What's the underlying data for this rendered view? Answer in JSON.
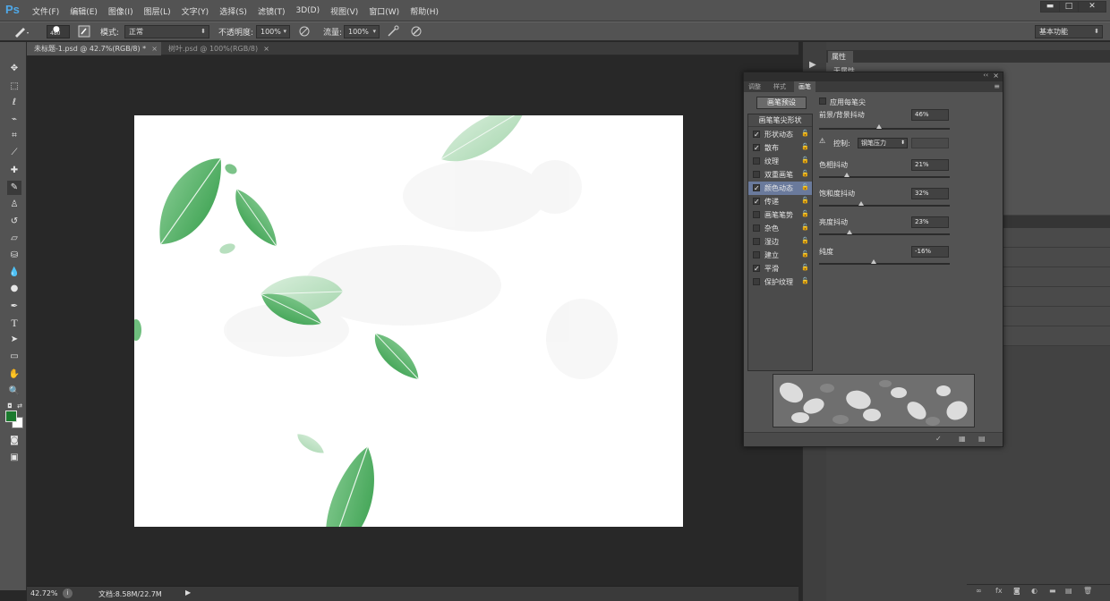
{
  "app": {
    "logo": "Ps"
  },
  "menu": [
    "文件(F)",
    "编辑(E)",
    "图像(I)",
    "图层(L)",
    "文字(Y)",
    "选择(S)",
    "滤镜(T)",
    "3D(D)",
    "视图(V)",
    "窗口(W)",
    "帮助(H)"
  ],
  "window_controls": {
    "minimize": "▬",
    "maximize": "□",
    "close": "✕"
  },
  "options": {
    "brush_size": "480",
    "mode_label": "模式:",
    "mode_value": "正常",
    "opacity_label": "不透明度:",
    "opacity_value": "100%",
    "flow_label": "流量:",
    "flow_value": "100%",
    "workspace_value": "基本功能"
  },
  "tabs": [
    {
      "label": "未标题-1.psd @ 42.7%(RGB/8) *",
      "active": true
    },
    {
      "label": "树叶.psd @ 100%(RGB/8)",
      "active": false
    }
  ],
  "status": {
    "zoom": "42.72%",
    "doc_info": "文档:8.58M/22.7M"
  },
  "colors": {
    "foreground": "#1b7a2e",
    "background": "#ffffff",
    "accent": "#4fa8e8"
  },
  "properties_panel": {
    "tab": "属性",
    "subtitle": "无属性"
  },
  "brush_panel": {
    "tabs": [
      "调整",
      "样式",
      "画笔"
    ],
    "preset_button": "画笔预设",
    "list_header": "画笔笔尖形状",
    "options": [
      {
        "label": "形状动态",
        "checked": true,
        "selected": false
      },
      {
        "label": "散布",
        "checked": true,
        "selected": false
      },
      {
        "label": "纹理",
        "checked": false,
        "selected": false
      },
      {
        "label": "双重画笔",
        "checked": false,
        "selected": false
      },
      {
        "label": "颜色动态",
        "checked": true,
        "selected": true
      },
      {
        "label": "传递",
        "checked": true,
        "selected": false
      },
      {
        "label": "画笔笔势",
        "checked": false,
        "selected": false
      },
      {
        "label": "杂色",
        "checked": false,
        "selected": false
      },
      {
        "label": "湿边",
        "checked": false,
        "selected": false
      },
      {
        "label": "建立",
        "checked": false,
        "selected": false
      },
      {
        "label": "平滑",
        "checked": true,
        "selected": false
      },
      {
        "label": "保护纹理",
        "checked": false,
        "selected": false
      }
    ],
    "apply_per_tip": "应用每笔尖",
    "fg_bg_jitter": {
      "label": "前景/背景抖动",
      "value": "46%",
      "level": 0.46
    },
    "control": {
      "label": "控制:",
      "value": "钢笔压力"
    },
    "hue_jitter": {
      "label": "色相抖动",
      "value": "21%",
      "level": 0.21
    },
    "saturation_jitter": {
      "label": "饱和度抖动",
      "value": "32%",
      "level": 0.32
    },
    "brightness_jitter": {
      "label": "亮度抖动",
      "value": "23%",
      "level": 0.23
    },
    "purity": {
      "label": "纯度",
      "value": "-16%",
      "level": 0.42
    }
  }
}
